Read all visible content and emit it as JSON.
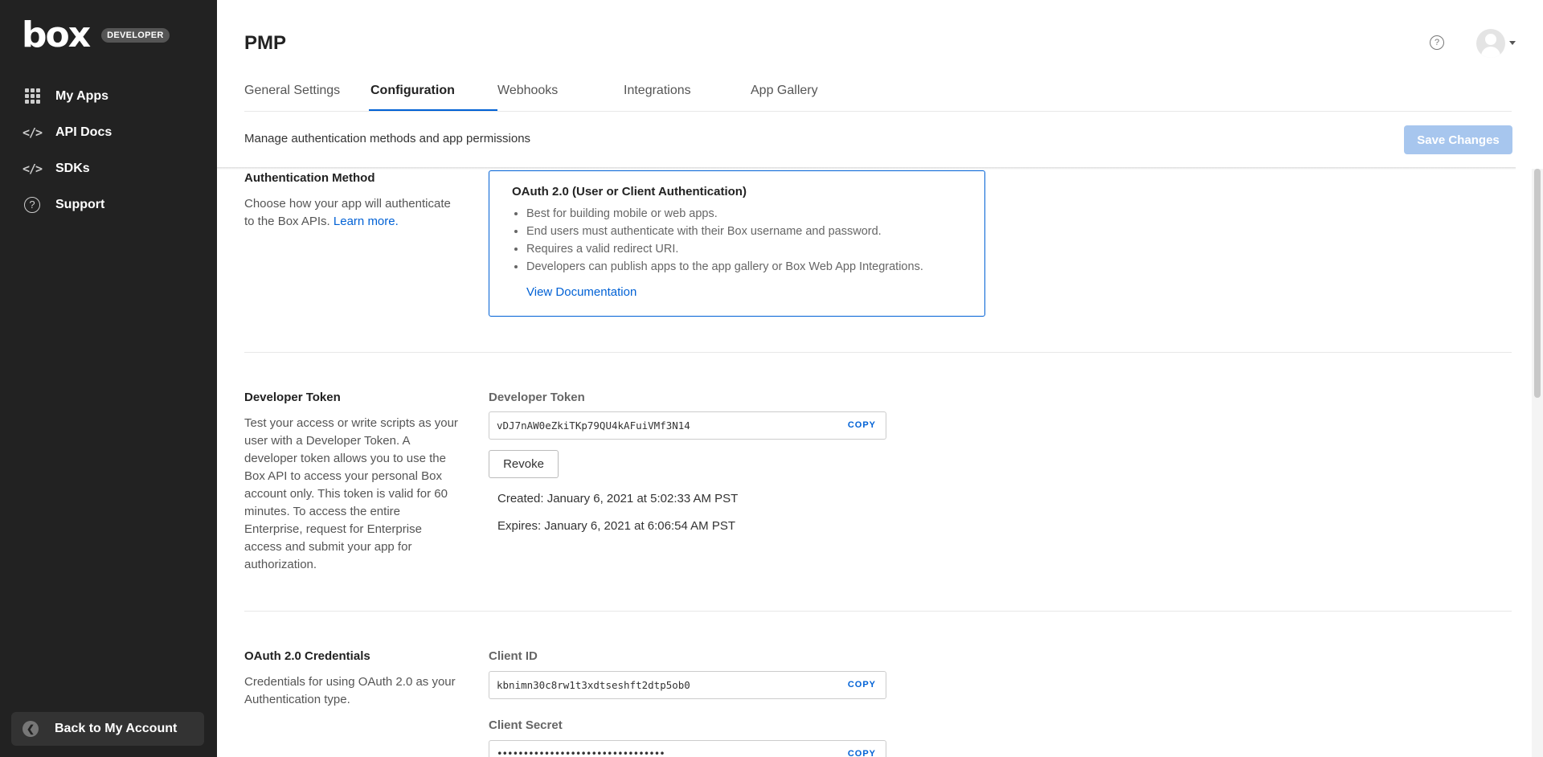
{
  "sidebar": {
    "logo": "box",
    "badge": "DEVELOPER",
    "items": [
      {
        "label": "My Apps",
        "icon": "grid-icon"
      },
      {
        "label": "API Docs",
        "icon": "code-icon"
      },
      {
        "label": "SDKs",
        "icon": "code-icon"
      },
      {
        "label": "Support",
        "icon": "help-icon"
      }
    ],
    "code_glyph": "</>",
    "help_glyph": "?",
    "back_label": "Back to My Account"
  },
  "header": {
    "title": "PMP",
    "help_glyph": "?"
  },
  "tabs": [
    {
      "label": "General Settings",
      "active": false
    },
    {
      "label": "Configuration",
      "active": true
    },
    {
      "label": "Webhooks",
      "active": false
    },
    {
      "label": "Integrations",
      "active": false
    },
    {
      "label": "App Gallery",
      "active": false
    }
  ],
  "subheader": {
    "text": "Manage authentication methods and app permissions",
    "save_label": "Save Changes"
  },
  "auth": {
    "title": "Authentication Method",
    "desc_prefix": "Choose how your app will authenticate to the Box APIs. ",
    "learn_more": "Learn more.",
    "card_title": "OAuth 2.0 (User or Client Authentication)",
    "bullets": [
      "Best for building mobile or web apps.",
      "End users must authenticate with their Box username and password.",
      "Requires a valid redirect URI.",
      "Developers can publish apps to the app gallery or Box Web App Integrations."
    ],
    "doc_link": "View Documentation"
  },
  "dev_token": {
    "title": "Developer Token",
    "desc": "Test your access or write scripts as your user with a Developer Token. A developer token allows you to use the Box API to access your personal Box account only. This token is valid for 60 minutes. To access the entire Enterprise, request for Enterprise access and submit your app for authorization.",
    "field_label": "Developer Token",
    "token": "vDJ7nAW0eZkiTKp79QU4kAFuiVMf3N14",
    "copy_label": "COPY",
    "revoke_label": "Revoke",
    "created": "Created: January 6, 2021 at 5:02:33 AM PST",
    "expires": "Expires: January 6, 2021 at 6:06:54 AM PST"
  },
  "oauth_creds": {
    "title": "OAuth 2.0 Credentials",
    "desc": "Credentials for using OAuth 2.0 as your Authentication type.",
    "client_id_label": "Client ID",
    "client_id": "kbnimn30c8rw1t3xdtseshft2dtp5ob0",
    "client_secret_label": "Client Secret",
    "client_secret": "••••••••••••••••••••••••••••••••",
    "copy_label": "COPY"
  },
  "colors": {
    "accent": "#0061d5",
    "sidebar_bg": "#222222",
    "save_disabled": "#a7c6ee"
  }
}
